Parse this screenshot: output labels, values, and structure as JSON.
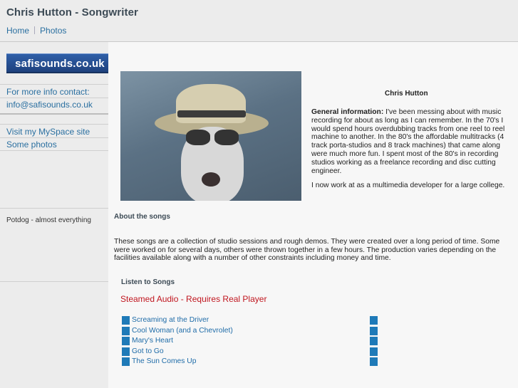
{
  "header": {
    "title": "Chris Hutton - Songwriter"
  },
  "nav": [
    {
      "label": "Home"
    },
    {
      "label": "Photos"
    }
  ],
  "sidebar": {
    "logo_text": "safisounds.co.uk",
    "contact_label": "For more info contact:",
    "contact_email": "info@safisounds.co.uk",
    "myspace_link": "Visit my MySpace site",
    "photos_link": "Some photos",
    "credit": "Potdog - almost everything"
  },
  "bio": {
    "title": "Chris Hutton",
    "general_label": "General information:",
    "general_text": " I've been messing about with music recording for about as long as I can remember. In the 70's I would spend hours overdubbing tracks from one reel to reel machine to another. In the 80's the affordable multitracks (4 track porta-studios and 8 track machines) that came along were much more fun. I spent most of the 80's in recording studios working as a freelance recording and disc cutting engineer.",
    "now_text": "I now work at as a multimedia developer for a large college."
  },
  "about": {
    "heading": "About the songs",
    "text": "These songs are a collection of studio sessions and rough demos. They were created over a long period of time. Some were worked on for several days, others were thrown together in a few hours. The production varies depending on the facilities available along with a number of other constraints including money and time."
  },
  "listen": {
    "heading": "Listen to Songs",
    "streamed_note": "Steamed Audio - Requires Real Player",
    "songs": [
      {
        "title": "Screaming at the Driver"
      },
      {
        "title": "Cool Woman (and a Chevrolet)"
      },
      {
        "title": "Mary's Heart"
      },
      {
        "title": "Got to Go"
      },
      {
        "title": "The Sun Comes Up"
      }
    ]
  },
  "colors": {
    "link": "#2a6fa0",
    "streamed_note": "#c0161f",
    "song_marker": "#1e7ab8",
    "logo_bg": "#2f5fa8"
  }
}
